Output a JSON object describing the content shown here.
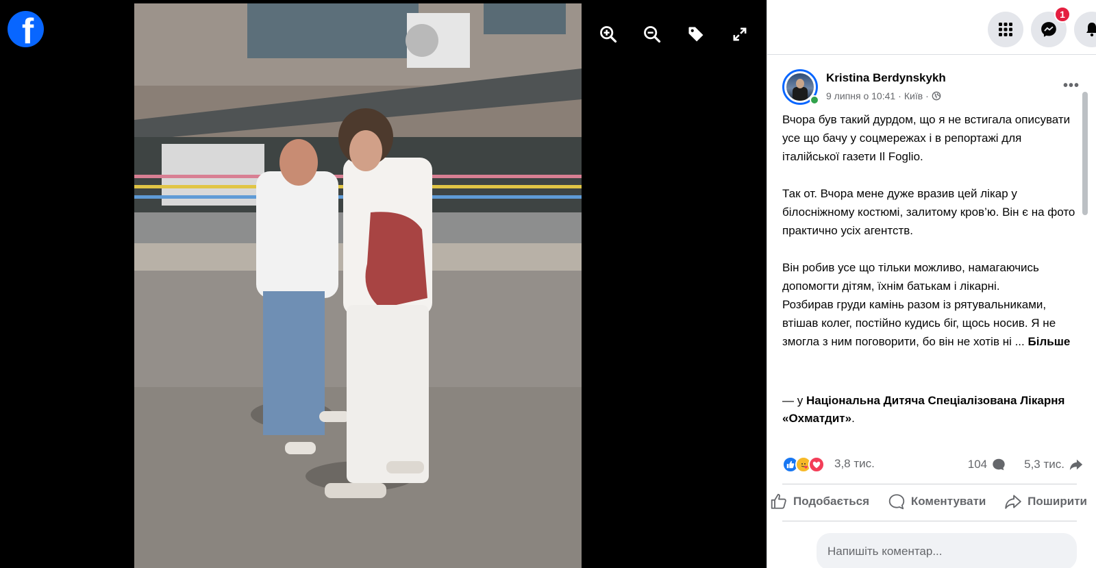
{
  "brand": {
    "logo_letter": "f",
    "color": "#0866ff"
  },
  "viewer": {
    "tools": [
      {
        "name": "zoom-in-icon"
      },
      {
        "name": "zoom-out-icon"
      },
      {
        "name": "tag-icon"
      },
      {
        "name": "fullscreen-icon"
      }
    ]
  },
  "topbar": {
    "menu_icon": "grid-menu-icon",
    "messenger_icon": "messenger-icon",
    "messenger_badge": "1",
    "notifications_icon": "bell-icon"
  },
  "post": {
    "author": "Kristina Berdynskykh",
    "date": "9 липня о 10:41",
    "separator": "·",
    "location": "Київ",
    "separator2": "·",
    "audience_icon": "globe-icon",
    "paragraph1": "Вчора був такий дурдом, що я не встигала описувати усе що бачу у соцмережах і в репортажі для італійської газети Il Foglio.",
    "paragraph2": "Так от. Вчора мене дуже вразив цей лікар у білосніжному костюмі, залитому кров’ю. Він є на фото практично усіх агентств.",
    "paragraph3": "Він робив усе що тільки можливо, намагаючись допомогти дітям, їхнім батькам і лікарні.",
    "paragraph4": "Розбирав груди камінь разом із рятувальниками, втішав колег, постійно кудись біг, щось носив. Я не змогла з ним поговорити, бо він не хотів ні ...",
    "more_label": "Більше",
    "checkin_prefix": "— у",
    "checkin_place": "Національна Дитяча Спеціалізована Лікарня «Охматдит»",
    "checkin_suffix": "."
  },
  "stats": {
    "reactions": "3,8 тис.",
    "comments": "104",
    "shares": "5,3 тис."
  },
  "actions": {
    "like": "Подобається",
    "comment": "Коментувати",
    "share": "Поширити"
  },
  "comment_input": {
    "placeholder": "Напишіть коментар..."
  },
  "colors": {
    "accent": "#0866ff",
    "badge": "#e41e3f",
    "online": "#31a24c",
    "muted": "#65676b"
  }
}
